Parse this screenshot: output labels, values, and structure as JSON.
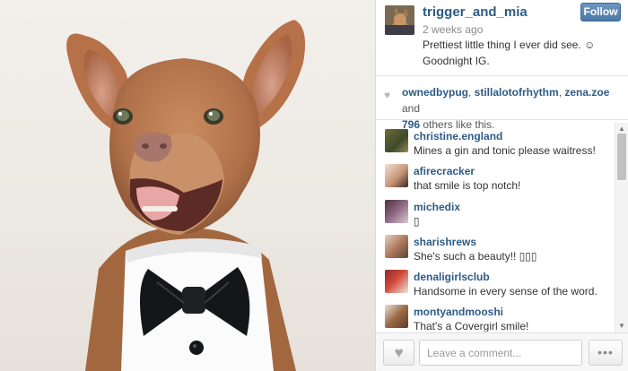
{
  "post": {
    "owner": "trigger_and_mia",
    "time": "2 weeks ago",
    "caption": "Prettiest little thing I ever did see. ☺ Goodnight IG.",
    "follow_label": "Follow"
  },
  "likes": {
    "users": [
      "ownedbypug",
      "stillalotofrhythm",
      "zena.zoe"
    ],
    "sep1": ", ",
    "sep2": ", ",
    "and_text": " and",
    "count": "796",
    "suffix": " others like this."
  },
  "comments": [
    {
      "user": "christine.england",
      "text": "Mines a gin and tonic please waitress!"
    },
    {
      "user": "afirecracker",
      "text": "that smile is top notch!"
    },
    {
      "user": "michedix",
      "text": "▯"
    },
    {
      "user": "sharishrews",
      "text": "She's such a beauty!! ▯▯▯"
    },
    {
      "user": "denaligirlsclub",
      "text": "Handsome in every sense of the word."
    },
    {
      "user": "montyandmooshi",
      "text": "That's a Covergirl smile!"
    }
  ],
  "footer": {
    "comment_placeholder": "Leave a comment...",
    "more_label": "•••"
  },
  "icons": {
    "heart": "heart-icon",
    "more": "ellipsis-icon",
    "scroll_up": "scroll-up-arrow",
    "scroll_down": "scroll-down-arrow"
  },
  "colors": {
    "link": "#2d5b86",
    "follow_button": "#4b7aa8"
  }
}
